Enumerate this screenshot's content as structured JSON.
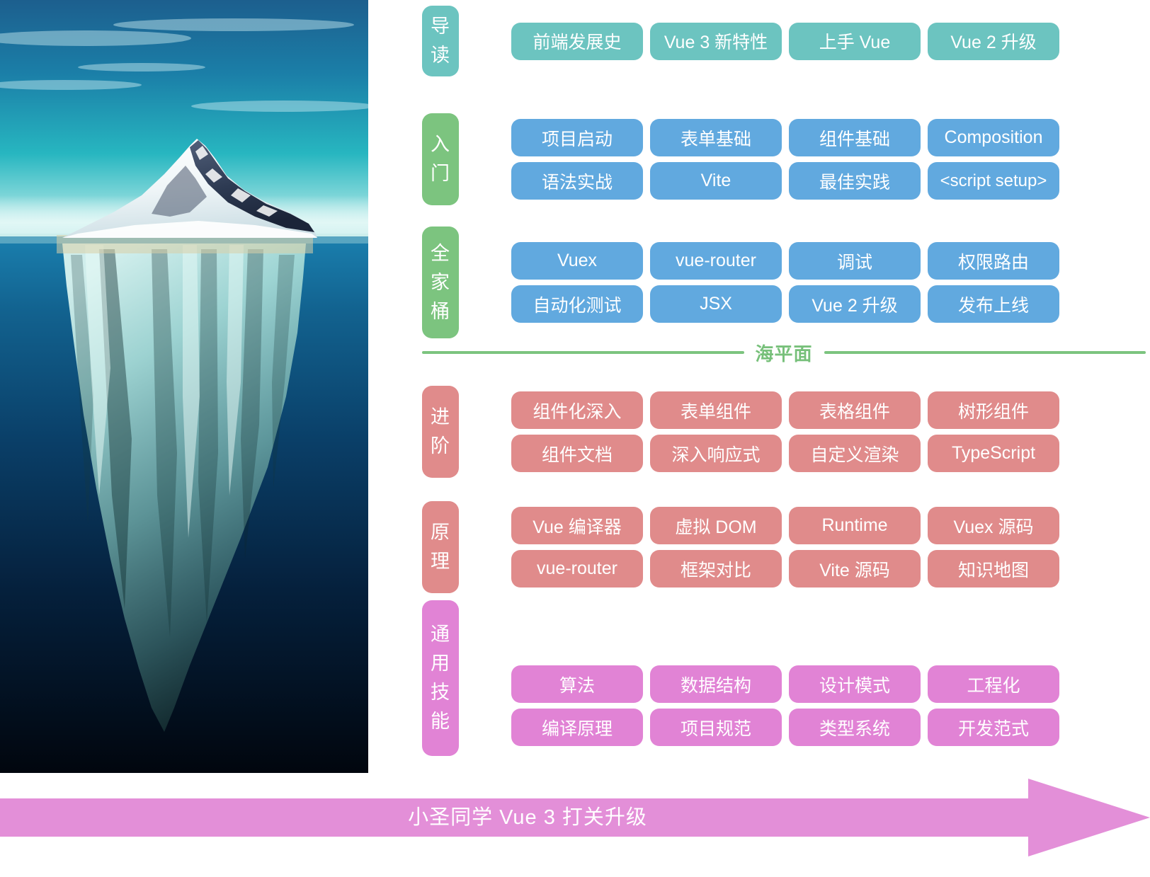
{
  "illustration": {
    "name": "iceberg-photo",
    "alt": "Iceberg above and below the waterline",
    "sky_color": "#1b6f9c",
    "water_color": "#0b3b63",
    "deep_water_color": "#020a14",
    "ice_color": "#f2f7f8"
  },
  "sea_level": {
    "label": "海平面",
    "color": "#77c07a"
  },
  "colors": {
    "teal": "#6cc4c0",
    "green": "#7cc47f",
    "blue": "#61a9df",
    "red": "#e08b8b",
    "pink": "#e183d5",
    "banner": "#e38fd8"
  },
  "sections": [
    {
      "id": "guide",
      "label": "导读",
      "label_chars": [
        "导",
        "读"
      ],
      "pill_color": "#6cc4c0",
      "chip_color": "#6cc4c0",
      "rows": [
        [
          "前端发展史",
          "Vue 3 新特性",
          "上手 Vue",
          "Vue 2 升级"
        ]
      ]
    },
    {
      "id": "getting-started",
      "label": "入门",
      "label_chars": [
        "入",
        "门"
      ],
      "pill_color": "#7cc47f",
      "chip_color": "#61a9df",
      "rows": [
        [
          "项目启动",
          "表单基础",
          "组件基础",
          "Composition"
        ],
        [
          "语法实战",
          "Vite",
          "最佳实践",
          "<script setup>"
        ]
      ]
    },
    {
      "id": "full-stack",
      "label": "全家桶",
      "label_chars": [
        "全",
        "家",
        "桶"
      ],
      "pill_color": "#7cc47f",
      "chip_color": "#61a9df",
      "rows": [
        [
          "Vuex",
          "vue-router",
          "调试",
          "权限路由"
        ],
        [
          "自动化测试",
          "JSX",
          "Vue 2 升级",
          "发布上线"
        ]
      ]
    },
    {
      "id": "advanced",
      "label": "进阶",
      "label_chars": [
        "进",
        "阶"
      ],
      "pill_color": "#e08b8b",
      "chip_color": "#e08b8b",
      "rows": [
        [
          "组件化深入",
          "表单组件",
          "表格组件",
          "树形组件"
        ],
        [
          "组件文档",
          "深入响应式",
          "自定义渲染",
          "TypeScript"
        ]
      ]
    },
    {
      "id": "principles",
      "label": "原理",
      "label_chars": [
        "原",
        "理"
      ],
      "pill_color": "#e08b8b",
      "chip_color": "#e08b8b",
      "rows": [
        [
          "Vue 编译器",
          "虚拟 DOM",
          "Runtime",
          "Vuex 源码"
        ],
        [
          "vue-router",
          "框架对比",
          "Vite 源码",
          "知识地图"
        ]
      ]
    },
    {
      "id": "general-skills",
      "label": "通用技能",
      "label_chars": [
        "通",
        "用",
        "技",
        "能"
      ],
      "pill_color": "#e183d5",
      "chip_color": "#e183d5",
      "rows": [
        [
          "算法",
          "数据结构",
          "设计模式",
          "工程化"
        ],
        [
          "编译原理",
          "项目规范",
          "类型系统",
          "开发范式"
        ]
      ]
    }
  ],
  "banner": {
    "text": "小圣同学 Vue 3 打关升级",
    "color": "#e38fd8"
  }
}
